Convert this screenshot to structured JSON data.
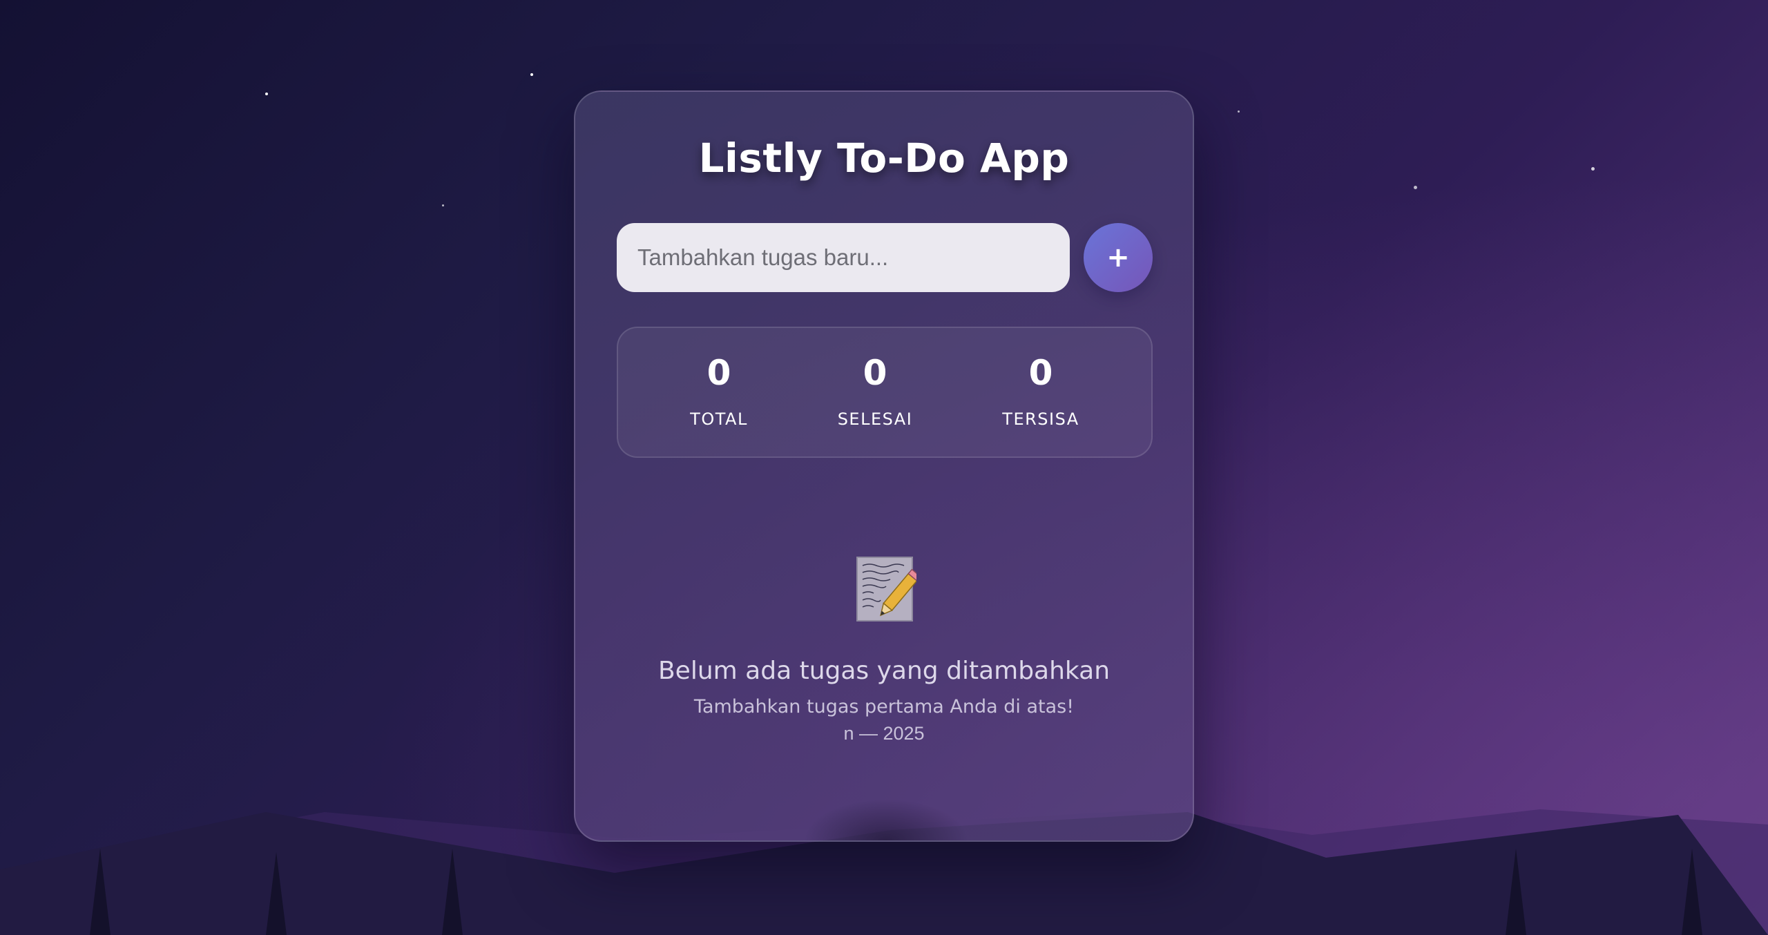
{
  "app": {
    "title": "Listly To-Do App"
  },
  "input": {
    "placeholder": "Tambahkan tugas baru...",
    "value": ""
  },
  "add_button": {
    "label": "+"
  },
  "stats": [
    {
      "value": "0",
      "label": "TOTAL"
    },
    {
      "value": "0",
      "label": "SELESAI"
    },
    {
      "value": "0",
      "label": "TERSISA"
    }
  ],
  "empty_state": {
    "icon": "memo-pencil-icon",
    "title": "Belum ada tugas yang ditambahkan",
    "subtitle": "Tambahkan tugas pertama Anda di atas!",
    "footer": "n — 2025"
  },
  "colors": {
    "background_start": "#141133",
    "background_end": "#5c3a80",
    "accent_start": "#6a74d8",
    "accent_end": "#7656b8",
    "input_background": "#ebe9f0"
  }
}
